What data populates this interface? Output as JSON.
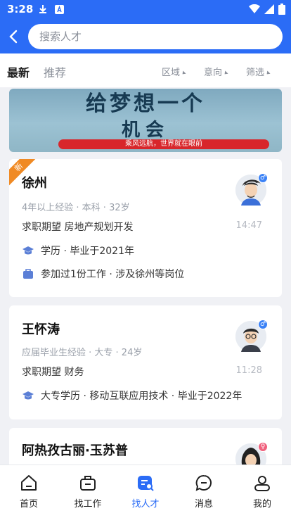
{
  "status": {
    "time": "3:28"
  },
  "search": {
    "placeholder": "搜索人才"
  },
  "tabs": {
    "latest": "最新",
    "recommend": "推荐"
  },
  "filters": [
    {
      "label": "区域"
    },
    {
      "label": "意向"
    },
    {
      "label": "筛选"
    }
  ],
  "banner": {
    "title_line1": "给梦想一个",
    "title_line2": "机会",
    "slogan": "乘风远航，世界就在眼前"
  },
  "candidates": [
    {
      "badge": "新",
      "name": "徐州",
      "meta": "4年以上经验 · 本科 · 32岁",
      "expectation": "求职期望 房地产规划开发",
      "time": "14:47",
      "gender": "♂",
      "details": [
        "学历 · 毕业于2021年",
        "参加过1份工作 · 涉及徐州等岗位"
      ]
    },
    {
      "name": "王怀涛",
      "meta": "应届毕业生经验 · 大专 · 24岁",
      "expectation": "求职期望 财务",
      "time": "11:28",
      "gender": "♂",
      "details": [
        "大专学历 · 移动互联应用技术 · 毕业于2022年"
      ]
    },
    {
      "name": "阿热孜古丽·玉苏普",
      "gender": "♀"
    }
  ],
  "nav": [
    {
      "label": "首页",
      "icon": "home-icon"
    },
    {
      "label": "找工作",
      "icon": "briefcase-icon"
    },
    {
      "label": "找人才",
      "icon": "talent-search-icon",
      "active": true
    },
    {
      "label": "消息",
      "icon": "message-icon"
    },
    {
      "label": "我的",
      "icon": "profile-icon"
    }
  ],
  "colors": {
    "primary": "#2b6cf6",
    "badge": "#f08a24"
  }
}
